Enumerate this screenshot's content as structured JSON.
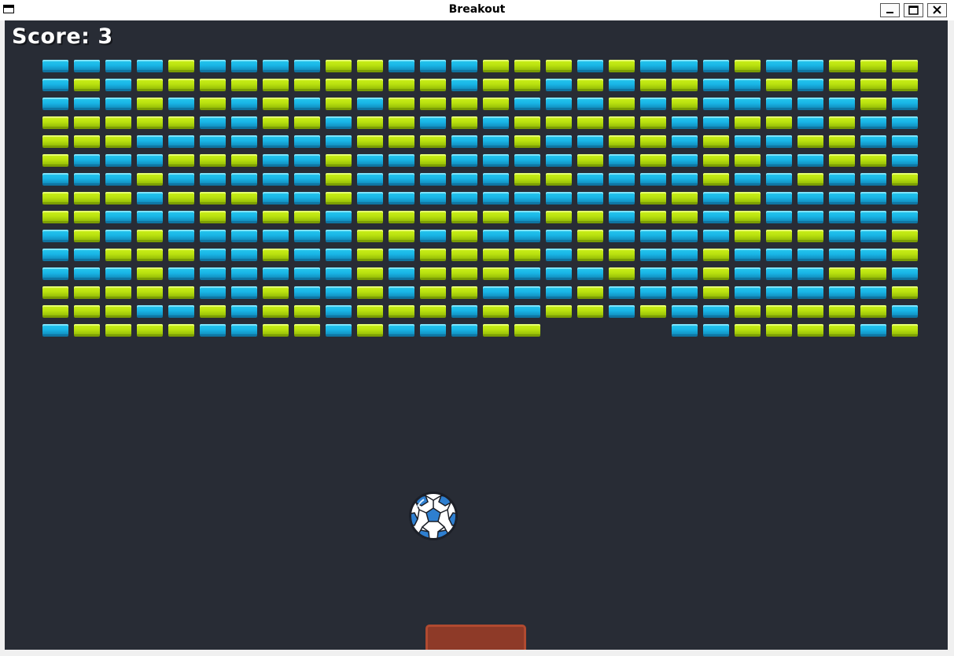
{
  "window": {
    "title": "Breakout",
    "icons": {
      "app": "app-window-icon",
      "minimize": "minimize-icon",
      "maximize": "maximize-icon",
      "close": "close-icon"
    }
  },
  "game": {
    "score_text": "Score: 3",
    "score": 3,
    "colors": {
      "background": "#282c35",
      "brick_cyan": "#19b5e6",
      "brick_lime": "#b9e10f",
      "paddle": "#8e3a28",
      "score_text": "#ffffff"
    },
    "ball_icon": "soccer-ball-icon",
    "brick_rows": [
      "CCCCLCCCCLLCCCLLLCLCCCLCCLLL",
      "CLCLLLLLLLLLLCLLCLCLLCCLCLLL",
      "CCCLCLCLCLCLLLLCCCLCLCCCCCLC",
      "LLLLLCCLLCLLCLCLLLLLCCLLCLCC",
      "LLLCCCCCCCLLLCCLCCLLCLCCLLCC",
      "LCCCLLLCCLCCLCCCCLCLCLLCCLLC",
      "CCCLCCCCCLCCCCCLLCCCCLCCLCCL",
      "LLLCLLLCCLCCCCCCCCCLLCLCCCCC",
      "LLCCCLCLLCLLLLLCLLCLLCLCCCCC",
      "CLCLCCCCCCLLCLCCCLCCCCLLLCCL",
      "CCLLLCCLCCLCLLLLCLLCCLCCCCCL",
      "CCCLCCCCCCLCLLLCCCLCCLCCCLLC",
      "LLLLLCCLCCLCLLCCCLCCCLCCCCCL",
      "LLLCCLCLLCLLLCLCLLCLCCLLLLLC",
      "CLLLLCCLLCLCCCLL....CCLLLLCL"
    ]
  }
}
